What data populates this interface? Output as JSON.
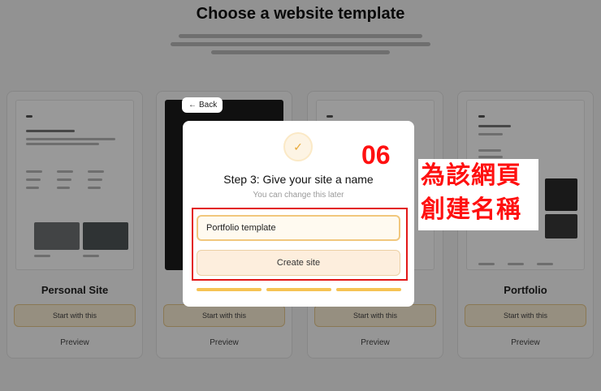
{
  "background": {
    "page_title": "Choose a website template",
    "cards": [
      {
        "name": "Personal Site",
        "start_label": "Start with this",
        "preview_label": "Preview"
      },
      {
        "name": "",
        "start_label": "Start with this",
        "preview_label": "Preview"
      },
      {
        "name": "",
        "start_label": "Start with this",
        "preview_label": "Preview"
      },
      {
        "name": "Portfolio",
        "start_label": "Start with this",
        "preview_label": "Preview"
      }
    ]
  },
  "back_button": {
    "label": "Back",
    "icon": "arrow-left-icon"
  },
  "modal": {
    "icon": "check-icon",
    "step_number": "06",
    "title": "Step 3: Give your site a name",
    "subtitle": "You can change this later",
    "site_name_input": {
      "value": "Portfolio template"
    },
    "create_button": "Create site",
    "progress": {
      "steps_total": 3,
      "steps_completed": 3
    }
  },
  "annotation": {
    "line1": "為該網頁",
    "line2": "創建名稱"
  },
  "colors": {
    "accent": "#f6c354",
    "highlight": "#e21818",
    "annotation_text": "#ff1010"
  }
}
